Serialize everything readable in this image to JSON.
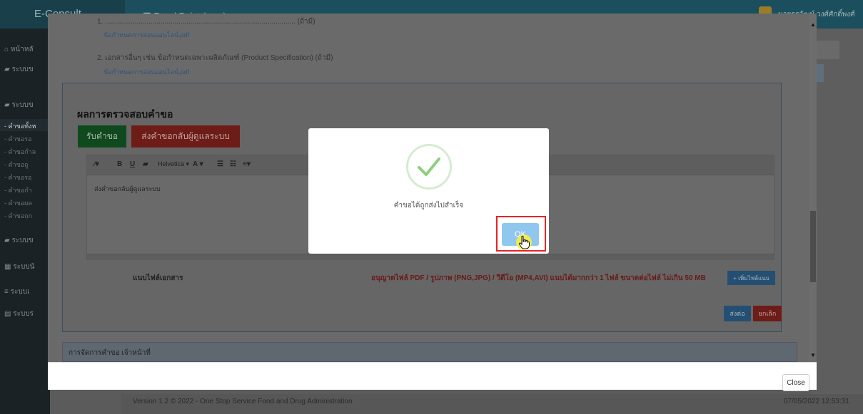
{
  "header": {
    "brand": "E-Consult",
    "title": "☰  Focal Point (ลดล) กองอาหาร",
    "user_name": "นายธรวัฒน์ วงศ์ศักดิ์พงศ์"
  },
  "sidebar": {
    "items": [
      {
        "label": "หน้าหลั"
      },
      {
        "label": "ระบบข"
      },
      {
        "label": "ระบบข"
      },
      {
        "label": "ระบบข"
      },
      {
        "label": "ระบบนั"
      },
      {
        "label": "ระบบเ"
      },
      {
        "label": "ระบบร"
      }
    ],
    "subitems": [
      {
        "label": "- คำขอทั้งห"
      },
      {
        "label": "- คำขอรอ"
      },
      {
        "label": "- คำขอกำล"
      },
      {
        "label": "- คำขอถู"
      },
      {
        "label": "- คำขอรอ"
      },
      {
        "label": "- คำขอกำ"
      },
      {
        "label": "- คำขอผล"
      },
      {
        "label": "- คำขอถก"
      }
    ]
  },
  "documents": {
    "item1": "1. ................................................................................................ (ถ้ามี)",
    "item1_link": "ข้อกำหนดการสอบออนไลน์.pdf",
    "item2": "2. เอกสารอื่นๆ เช่น ข้อกำหนดเฉพาะผลิตภัณฑ์ (Product Specification) (ถ้ามี)",
    "item2_link": "ข้อกำหนดการสอบออนไลน์.pdf"
  },
  "review": {
    "title": "ผลการตรวจสอบคำขอ",
    "accept_label": "รับคำขอ",
    "return_label": "ส่งคำขอกลับผู้ดูแลระบบ",
    "toolbar": {
      "font": "Helvetica ▾"
    },
    "editor_text": "ส่งคำขอกลับผู้ดูแลระบบ",
    "attach_label": "แนบไฟล์เอกสาร",
    "attach_rule": "อนุญาตไฟล์ PDF / รูปภาพ (PNG,JPG) / วีดีโอ (MP4,AVI) แนบได้มากกว่า 1 ไฟล์ ขนาดต่อไฟล์ ไม่เกิน 50 MB",
    "add_file_label": "+ เพิ่มไฟล์แนบ",
    "submit_label": "ส่งต่อ",
    "cancel_label": "ยกเลิก"
  },
  "management": {
    "title": "การจัดการคำขอ เจ้าหน้าที่"
  },
  "modal": {
    "close_label": "Close"
  },
  "dialog": {
    "message": "คำขอได้ถูกส่งไปสำเร็จ",
    "ok_label": "OK"
  },
  "footer": {
    "version": "Version 1.2 © 2022 - One Stop Service Food and Drug Administration",
    "datetime": "07/05/2022 12:53:31"
  },
  "colors": {
    "highlight": "#e52329",
    "ok_button": "#8fc7ef",
    "success_check": "#8ccf7e"
  }
}
